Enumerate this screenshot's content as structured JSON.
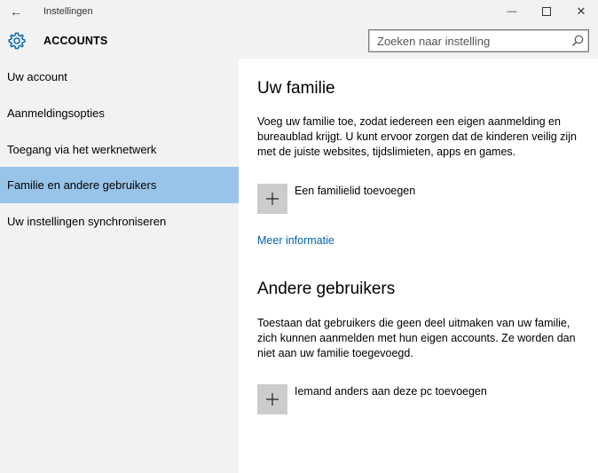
{
  "window": {
    "title": "Instellingen",
    "back_symbol": "←",
    "minimize_symbol": "—",
    "close_symbol": "✕"
  },
  "header": {
    "section_title": "ACCOUNTS",
    "search": {
      "placeholder": "Zoeken naar instelling",
      "value": ""
    }
  },
  "sidebar": {
    "items": [
      {
        "label": "Uw account",
        "active": false
      },
      {
        "label": "Aanmeldingsopties",
        "active": false
      },
      {
        "label": "Toegang via het werknetwerk",
        "active": false
      },
      {
        "label": "Familie en andere gebruikers",
        "active": true
      },
      {
        "label": "Uw instellingen synchroniseren",
        "active": false
      }
    ]
  },
  "main": {
    "family": {
      "heading": "Uw familie",
      "description": "Voeg uw familie toe, zodat iedereen een eigen aanmelding en bureaublad krijgt. U kunt ervoor zorgen dat de kinderen veilig zijn met de juiste websites, tijdslimieten, apps en games.",
      "add_label": "Een familielid toevoegen",
      "more_info_link": "Meer informatie"
    },
    "others": {
      "heading": "Andere gebruikers",
      "description": "Toestaan dat gebruikers die geen deel uitmaken van uw familie, zich kunnen aanmelden met hun eigen accounts. Ze worden dan niet aan uw familie toegevoegd.",
      "add_label": "Iemand anders aan deze pc toevoegen"
    }
  },
  "colors": {
    "accent": "#0063b1",
    "nav_selected": "#99c4ea",
    "sidebar_bg": "#f2f2f2",
    "content_bg": "#ffffff",
    "plus_tile": "#cccccc"
  }
}
